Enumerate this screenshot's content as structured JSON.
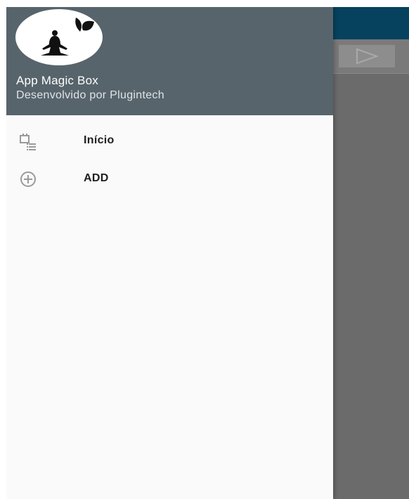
{
  "drawer": {
    "header": {
      "logo_icon": "meditation-logo-icon",
      "title": "App Magic Box",
      "subtitle": "Desenvolvido por Plugintech"
    },
    "items": [
      {
        "label": "Início",
        "icon": "schedule-list-icon"
      },
      {
        "label": "ADD",
        "icon": "add-circle-icon"
      }
    ]
  },
  "background_app": {
    "toolbar": {
      "play_icon": "play-outline-icon"
    }
  },
  "colors": {
    "header_bg": "#57646b",
    "appbar_bg": "#06425e",
    "drawer_bg": "#fafafa",
    "icon_gray": "#9a9a9a"
  }
}
